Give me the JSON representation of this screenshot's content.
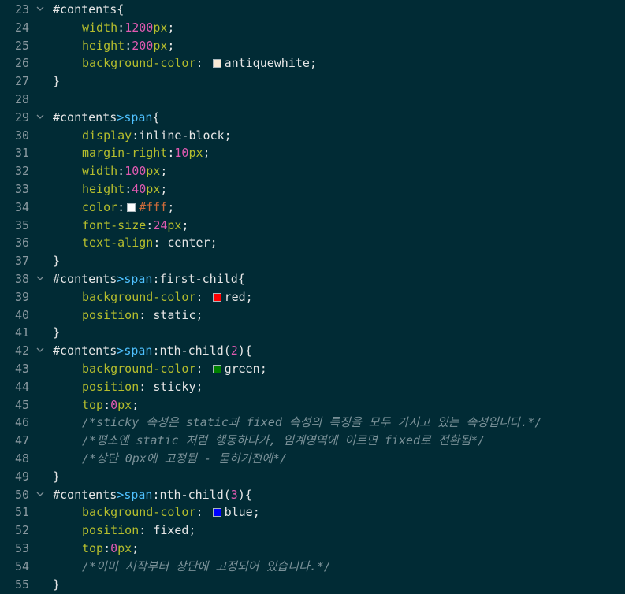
{
  "editor": {
    "colors": {
      "background": "#012b35",
      "selector": "#e6e6e6",
      "tag": "#4fc1ff",
      "property": "#b5bd2d",
      "number": "#e05ab0",
      "hex_value": "#cc6b3a",
      "comment": "#7a9198"
    },
    "fold_icon": "chevron-down-icon",
    "lines": [
      {
        "n": "23",
        "fold": true,
        "tokens": [
          {
            "t": "#contents",
            "c": "sel"
          },
          {
            "t": "{",
            "c": "punc"
          }
        ]
      },
      {
        "n": "24",
        "indent": true,
        "tokens": [
          {
            "t": "width",
            "c": "prop"
          },
          {
            "t": ":",
            "c": "punc"
          },
          {
            "t": "1200",
            "c": "num"
          },
          {
            "t": "px",
            "c": "unit"
          },
          {
            "t": ";",
            "c": "punc"
          }
        ]
      },
      {
        "n": "25",
        "indent": true,
        "tokens": [
          {
            "t": "height",
            "c": "prop"
          },
          {
            "t": ":",
            "c": "punc"
          },
          {
            "t": "200",
            "c": "num"
          },
          {
            "t": "px",
            "c": "unit"
          },
          {
            "t": ";",
            "c": "punc"
          }
        ]
      },
      {
        "n": "26",
        "indent": true,
        "tokens": [
          {
            "t": "background-color",
            "c": "prop"
          },
          {
            "t": ": ",
            "c": "punc"
          },
          {
            "swatch": "#faebd7"
          },
          {
            "t": "antiquewhite",
            "c": "val"
          },
          {
            "t": ";",
            "c": "punc"
          }
        ]
      },
      {
        "n": "27",
        "tokens": [
          {
            "t": "}",
            "c": "punc"
          }
        ]
      },
      {
        "n": "28",
        "tokens": []
      },
      {
        "n": "29",
        "fold": true,
        "tokens": [
          {
            "t": "#contents",
            "c": "sel"
          },
          {
            "t": ">",
            "c": "tag"
          },
          {
            "t": "span",
            "c": "tag"
          },
          {
            "t": "{",
            "c": "punc"
          }
        ]
      },
      {
        "n": "30",
        "indent": true,
        "tokens": [
          {
            "t": "display",
            "c": "prop"
          },
          {
            "t": ":",
            "c": "punc"
          },
          {
            "t": "inline-block",
            "c": "val"
          },
          {
            "t": ";",
            "c": "punc"
          }
        ]
      },
      {
        "n": "31",
        "indent": true,
        "tokens": [
          {
            "t": "margin-right",
            "c": "prop"
          },
          {
            "t": ":",
            "c": "punc"
          },
          {
            "t": "10",
            "c": "num"
          },
          {
            "t": "px",
            "c": "unit"
          },
          {
            "t": ";",
            "c": "punc"
          }
        ]
      },
      {
        "n": "32",
        "indent": true,
        "tokens": [
          {
            "t": "width",
            "c": "prop"
          },
          {
            "t": ":",
            "c": "punc"
          },
          {
            "t": "100",
            "c": "num"
          },
          {
            "t": "px",
            "c": "unit"
          },
          {
            "t": ";",
            "c": "punc"
          }
        ]
      },
      {
        "n": "33",
        "indent": true,
        "tokens": [
          {
            "t": "height",
            "c": "prop"
          },
          {
            "t": ":",
            "c": "punc"
          },
          {
            "t": "40",
            "c": "num"
          },
          {
            "t": "px",
            "c": "unit"
          },
          {
            "t": ";",
            "c": "punc"
          }
        ]
      },
      {
        "n": "34",
        "indent": true,
        "tokens": [
          {
            "t": "color",
            "c": "prop"
          },
          {
            "t": ":",
            "c": "punc"
          },
          {
            "swatch": "#ffffff"
          },
          {
            "t": "#fff",
            "c": "hex"
          },
          {
            "t": ";",
            "c": "punc"
          }
        ]
      },
      {
        "n": "35",
        "indent": true,
        "tokens": [
          {
            "t": "font-size",
            "c": "prop"
          },
          {
            "t": ":",
            "c": "punc"
          },
          {
            "t": "24",
            "c": "num"
          },
          {
            "t": "px",
            "c": "unit"
          },
          {
            "t": ";",
            "c": "punc"
          }
        ]
      },
      {
        "n": "36",
        "indent": true,
        "tokens": [
          {
            "t": "text-align",
            "c": "prop"
          },
          {
            "t": ": ",
            "c": "punc"
          },
          {
            "t": "center",
            "c": "val"
          },
          {
            "t": ";",
            "c": "punc"
          }
        ]
      },
      {
        "n": "37",
        "tokens": [
          {
            "t": "}",
            "c": "punc"
          }
        ]
      },
      {
        "n": "38",
        "fold": true,
        "tokens": [
          {
            "t": "#contents",
            "c": "sel"
          },
          {
            "t": ">",
            "c": "tag"
          },
          {
            "t": "span",
            "c": "tag"
          },
          {
            "t": ":first-child",
            "c": "val"
          },
          {
            "t": "{",
            "c": "punc"
          }
        ]
      },
      {
        "n": "39",
        "indent": true,
        "tokens": [
          {
            "t": "background-color",
            "c": "prop"
          },
          {
            "t": ": ",
            "c": "punc"
          },
          {
            "swatch": "#ff0000"
          },
          {
            "t": "red",
            "c": "val"
          },
          {
            "t": ";",
            "c": "punc"
          }
        ]
      },
      {
        "n": "40",
        "indent": true,
        "tokens": [
          {
            "t": "position",
            "c": "prop"
          },
          {
            "t": ": ",
            "c": "punc"
          },
          {
            "t": "static",
            "c": "val"
          },
          {
            "t": ";",
            "c": "punc"
          }
        ]
      },
      {
        "n": "41",
        "tokens": [
          {
            "t": "}",
            "c": "punc"
          }
        ]
      },
      {
        "n": "42",
        "fold": true,
        "tokens": [
          {
            "t": "#contents",
            "c": "sel"
          },
          {
            "t": ">",
            "c": "tag"
          },
          {
            "t": "span",
            "c": "tag"
          },
          {
            "t": ":nth-child(",
            "c": "val"
          },
          {
            "t": "2",
            "c": "num"
          },
          {
            "t": "){",
            "c": "punc"
          }
        ]
      },
      {
        "n": "43",
        "indent": true,
        "tokens": [
          {
            "t": "background-color",
            "c": "prop"
          },
          {
            "t": ": ",
            "c": "punc"
          },
          {
            "swatch": "#008000"
          },
          {
            "t": "green",
            "c": "val"
          },
          {
            "t": ";",
            "c": "punc"
          }
        ]
      },
      {
        "n": "44",
        "indent": true,
        "tokens": [
          {
            "t": "position",
            "c": "prop"
          },
          {
            "t": ": ",
            "c": "punc"
          },
          {
            "t": "sticky",
            "c": "val"
          },
          {
            "t": ";",
            "c": "punc"
          }
        ]
      },
      {
        "n": "45",
        "indent": true,
        "tokens": [
          {
            "t": "top",
            "c": "prop"
          },
          {
            "t": ":",
            "c": "punc"
          },
          {
            "t": "0",
            "c": "num"
          },
          {
            "t": "px",
            "c": "unit"
          },
          {
            "t": ";",
            "c": "punc"
          }
        ]
      },
      {
        "n": "46",
        "indent": true,
        "tokens": [
          {
            "t": "/*sticky 속성은 static과 fixed 속성의 특징을 모두 가지고 있는 속성입니다.*/",
            "c": "comment"
          }
        ]
      },
      {
        "n": "47",
        "indent": true,
        "tokens": [
          {
            "t": "/*평소엔 static 처럼 행동하다가, 임계영역에 이르면 fixed로 전환됨*/",
            "c": "comment"
          }
        ]
      },
      {
        "n": "48",
        "indent": true,
        "tokens": [
          {
            "t": "/*상단 0px에 고정됨 - 묻히기전에*/",
            "c": "comment"
          }
        ]
      },
      {
        "n": "49",
        "tokens": [
          {
            "t": "}",
            "c": "punc"
          }
        ]
      },
      {
        "n": "50",
        "fold": true,
        "tokens": [
          {
            "t": "#contents",
            "c": "sel"
          },
          {
            "t": ">",
            "c": "tag"
          },
          {
            "t": "span",
            "c": "tag"
          },
          {
            "t": ":nth-child(",
            "c": "val"
          },
          {
            "t": "3",
            "c": "num"
          },
          {
            "t": "){",
            "c": "punc"
          }
        ]
      },
      {
        "n": "51",
        "indent": true,
        "tokens": [
          {
            "t": "background-color",
            "c": "prop"
          },
          {
            "t": ": ",
            "c": "punc"
          },
          {
            "swatch": "#0000ff"
          },
          {
            "t": "blue",
            "c": "val"
          },
          {
            "t": ";",
            "c": "punc"
          }
        ]
      },
      {
        "n": "52",
        "indent": true,
        "tokens": [
          {
            "t": "position",
            "c": "prop"
          },
          {
            "t": ": ",
            "c": "punc"
          },
          {
            "t": "fixed",
            "c": "val"
          },
          {
            "t": ";",
            "c": "punc"
          }
        ]
      },
      {
        "n": "53",
        "indent": true,
        "tokens": [
          {
            "t": "top",
            "c": "prop"
          },
          {
            "t": ":",
            "c": "punc"
          },
          {
            "t": "0",
            "c": "num"
          },
          {
            "t": "px",
            "c": "unit"
          },
          {
            "t": ";",
            "c": "punc"
          }
        ]
      },
      {
        "n": "54",
        "indent": true,
        "tokens": [
          {
            "t": "/*이미 시작부터 상단에 고정되어 있습니다.*/",
            "c": "comment"
          }
        ]
      },
      {
        "n": "55",
        "tokens": [
          {
            "t": "}",
            "c": "punc"
          }
        ]
      }
    ]
  }
}
